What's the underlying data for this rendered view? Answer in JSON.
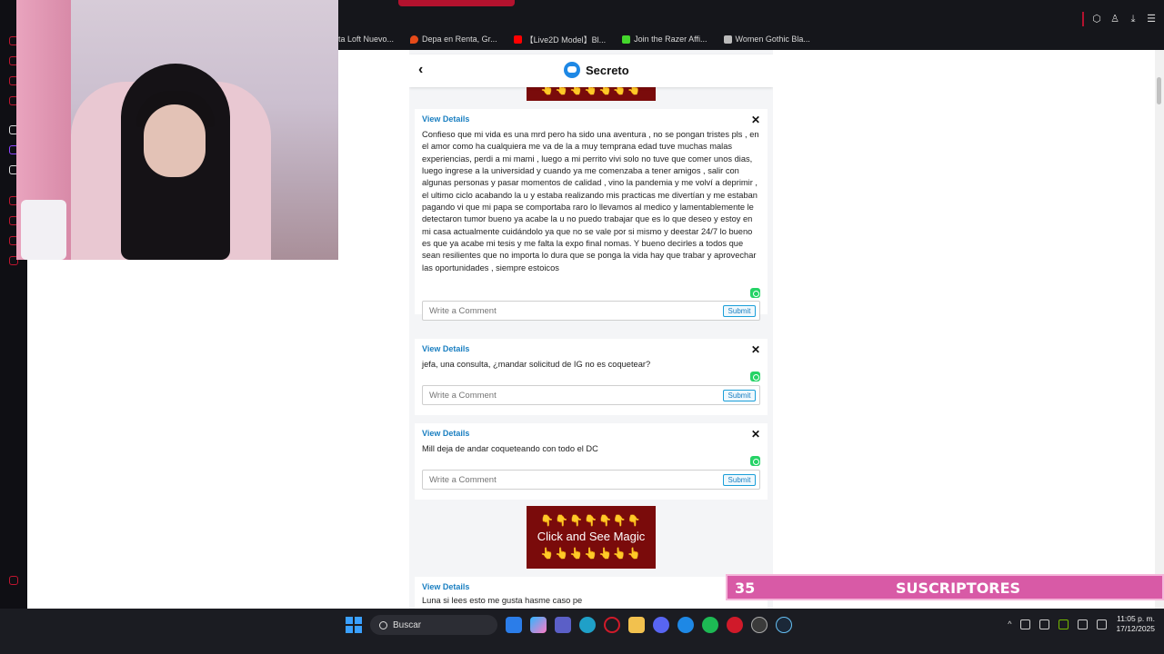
{
  "browser": {
    "bookmarks": [
      {
        "label": "ta Loft Nuevo...",
        "icon": "house-icon",
        "color": "#9aa0a6"
      },
      {
        "label": "Depa en Renta, Gr...",
        "icon": "location-pin-icon",
        "color": "#e64a19"
      },
      {
        "label": "【Live2D Model】Bl...",
        "icon": "youtube-icon",
        "color": "#ff0000"
      },
      {
        "label": "Join the Razer Affi...",
        "icon": "razer-icon",
        "color": "#44d62c"
      },
      {
        "label": "Women Gothic Bla...",
        "icon": "link-icon",
        "color": "#bbbbbb"
      }
    ]
  },
  "header": {
    "title": "Secreto"
  },
  "ads": {
    "top": {
      "emojis": "👆👆👆👆👆👆👆"
    },
    "bottom": {
      "emojis_top": "👇👇👇👇👇👇👇",
      "text": "Click and See Magic",
      "emojis_bottom": "👆👆👆👆👆👆👆"
    }
  },
  "posts": [
    {
      "view_details": "View Details",
      "text": "Confieso que mi vida es una mrd pero ha sido una aventura , no se pongan tristes pls , en el amor como ha cualquiera me va de la a muy temprana edad tuve muchas malas experiencias, perdi a mi mami , luego a mi perrito vivi solo no tuve que comer unos dias, luego ingrese a la universidad y cuando ya me comenzaba a tener amigos , salir con algunas personas y pasar momentos de calidad , vino la pandemia y me volví a deprimir , el ultimo ciclo acabando la u y estaba realizando mis practicas me divertían y me estaban pagando vi que mi papa se comportaba raro lo llevamos al medico y lamentablemente le detectaron tumor bueno ya acabe la u no puedo trabajar que es lo que deseo y estoy en mi casa actualmente cuidándolo ya que no se vale por si mismo y deestar 24/7 lo bueno es que ya acabe mi tesis y me falta la expo final nomas. Y bueno decirles a todos que sean resilientes que no importa lo dura que se ponga la vida hay que trabar y aprovechar las oportunidades , siempre estoicos",
      "comment_placeholder": "Write a Comment",
      "submit": "Submit"
    },
    {
      "view_details": "View Details",
      "text": "jefa, una consulta, ¿mandar solicitud de IG no es coquetear?",
      "comment_placeholder": "Write a Comment",
      "submit": "Submit"
    },
    {
      "view_details": "View Details",
      "text": "Mill deja de andar coqueteando con todo el DC",
      "comment_placeholder": "Write a Comment",
      "submit": "Submit"
    },
    {
      "view_details": "View Details",
      "text": "Luna si lees esto me gusta hasme caso pe"
    }
  ],
  "overlay": {
    "subscriber_count": "35",
    "subscriber_label": "SUSCRIPTORES"
  },
  "taskbar": {
    "search_label": "Buscar",
    "apps": [
      "file-explorer-icon",
      "copilot-icon",
      "teams-icon",
      "edge-icon",
      "opera-icon",
      "folder-icon",
      "discord-icon",
      "app-icon",
      "spotify-icon",
      "opera-gx-icon",
      "obs-icon",
      "steam-icon"
    ],
    "time": "11:05 p. m.",
    "date": "17/12/2025"
  },
  "colors": {
    "accent_link": "#1a7fc1",
    "ad_background": "#7a0b0b",
    "overlay_pink": "#d85aa6",
    "whatsapp": "#25d366"
  }
}
